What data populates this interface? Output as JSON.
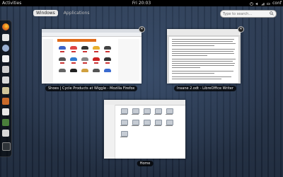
{
  "topbar": {
    "activities": "Activities",
    "clock": "Fri 20:03",
    "user": "conf"
  },
  "tabs": [
    {
      "label": "Windows",
      "active": true
    },
    {
      "label": "Applications",
      "active": false
    }
  ],
  "search": {
    "placeholder": "Type to search..."
  },
  "dash_icons": [
    "firefox-icon",
    "evolution-icon",
    "empathy-icon",
    "rhythmbox-icon",
    "shotwell-icon",
    "writer-icon",
    "files-icon",
    "software-icon",
    "help-icon",
    "terminal-icon",
    "workspace-icon",
    "apps-icon"
  ],
  "windows": {
    "firefox": {
      "caption": "Shoes | Cycle Products at Wiggle - Mozilla Firefox"
    },
    "writer": {
      "caption": "Insane 2.odt - LibreOffice Writer"
    },
    "files": {
      "caption": "Home"
    }
  },
  "colors": {
    "accent_orange": "#e06b1a",
    "topbar": "#000000",
    "backdrop": "#1e2a3c"
  }
}
